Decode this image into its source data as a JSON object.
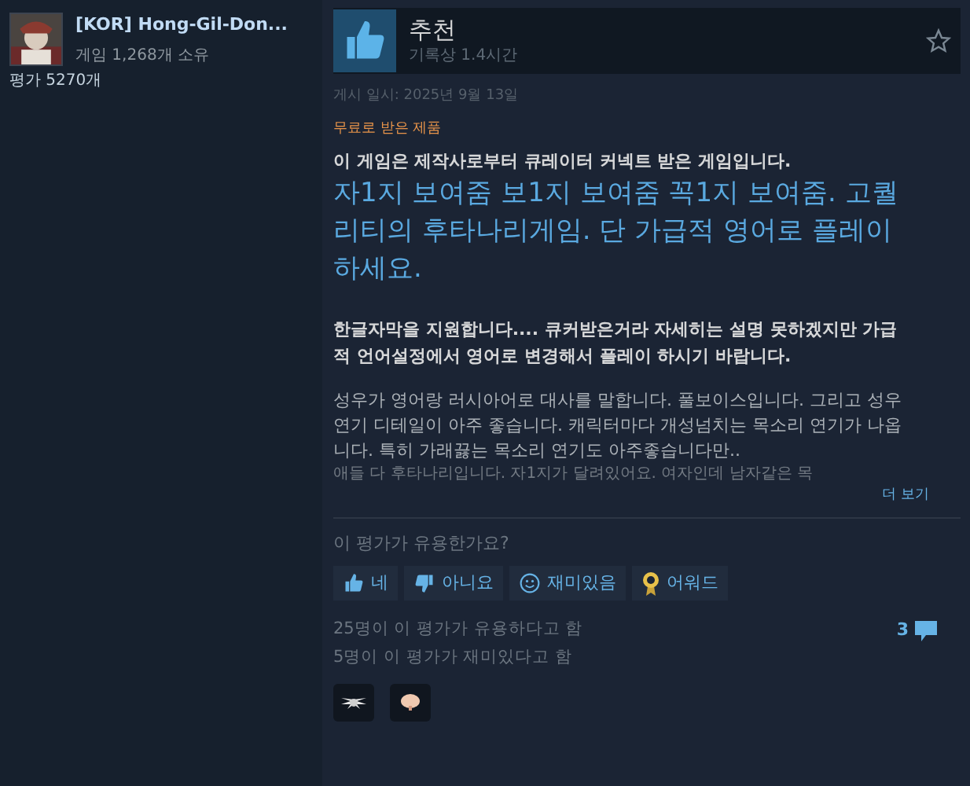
{
  "reviewer": {
    "name": "[KOR] Hong-Gil-Don...",
    "games": "게임 1,268개 소유",
    "reviews": "평가 5270개"
  },
  "review": {
    "verdict": "추천",
    "recommended": true,
    "hours": "기록상 1.4시간",
    "posted": "게시 일시: 2025년 9월 13일",
    "free_label": "무료로 받은 제품",
    "paragraphs": [
      {
        "kind": "bold",
        "text": "이 게임은 제작사로부터 큐레이터 커넥트 받은 게임입니다."
      },
      {
        "kind": "large",
        "text": "자1지 보여줌 보1지 보여줌 꼭1지 보여줌. 고퀄리티의 후타나리게임. 단 가급적 영어로 플레이하세요."
      },
      {
        "kind": "bold",
        "text": "한글자막을 지원합니다.... 큐커받은거라 자세히는 설명 못하겠지만 가급적 언어설정에서 영어로 변경해서 플레이 하시기 바랍니다."
      },
      {
        "kind": "normal",
        "text": "성우가 영어랑 러시아어로 대사를 말합니다. 풀보이스입니다. 그리고 성우연기 디테일이 아주 좋습니다. 캐릭터마다 개성넘치는 목소리 연기가 나옵니다. 특히 가래끓는 목소리 연기도 아주좋습니다만.."
      },
      {
        "kind": "faded",
        "text": "애들 다 후타나리입니다. 자1지가 달려있어요. 여자인데 남자같은 목"
      }
    ],
    "read_more": "더 보기"
  },
  "vote": {
    "prompt": "이 평가가 유용한가요?",
    "buttons": [
      {
        "kind": "yes",
        "label": "네"
      },
      {
        "kind": "no",
        "label": "아니요"
      },
      {
        "kind": "funny",
        "label": "재미있음"
      },
      {
        "kind": "award",
        "label": "어워드"
      }
    ]
  },
  "stats": [
    "25명이 이 평가가 유용하다고 함",
    "5명이 이 평가가 재미있다고 함"
  ],
  "comments": "3",
  "awards": [
    {
      "kind": "wings"
    },
    {
      "kind": "brain"
    }
  ]
}
